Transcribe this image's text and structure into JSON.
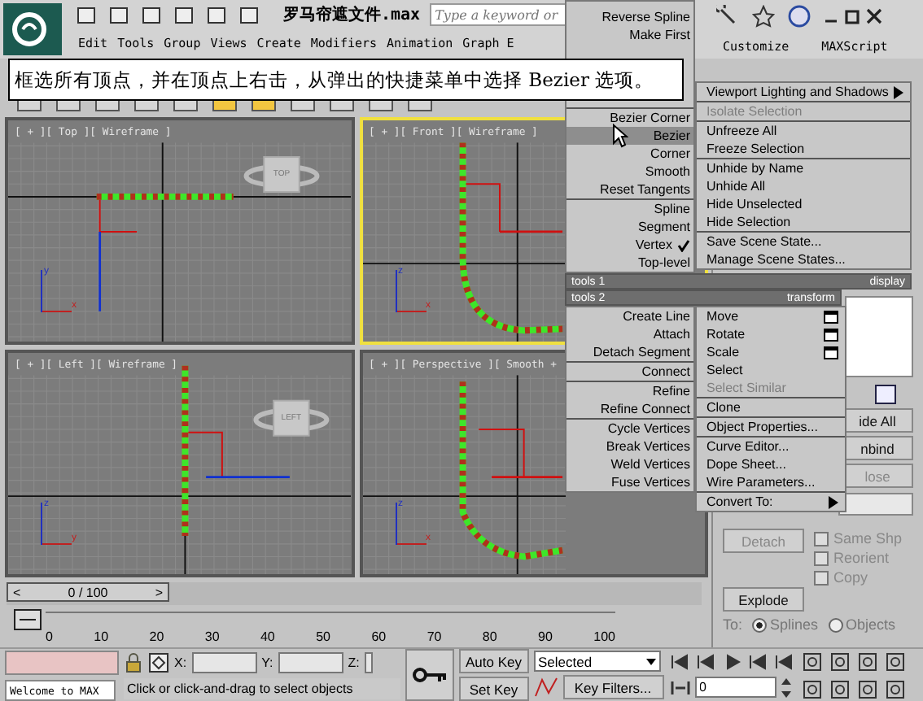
{
  "title_bar": {
    "file_name": "罗马帘遮文件.max",
    "search": {
      "placeholder": "Type a keyword or"
    }
  },
  "menu_bar": [
    "Edit",
    "Tools",
    "Group",
    "Views",
    "Create",
    "Modifiers",
    "Animation",
    "Graph E"
  ],
  "menu_bar_right": [
    "Customize",
    "MAXScript"
  ],
  "caption": "框选所有顶点，并在顶点上右击，从弹出的快捷菜单中选择 Bezier 选项。",
  "viewports": [
    {
      "label": "[ + ][ Top ][ Wireframe ]",
      "selected": false,
      "viewcube": "TOP",
      "tripod": [
        "y",
        "x"
      ]
    },
    {
      "label": "[ + ][ Front ][ Wireframe ]",
      "selected": true,
      "tripod": [
        "z",
        "x"
      ]
    },
    {
      "label": "[ + ][ Left ][ Wireframe ]",
      "selected": false,
      "viewcube": "LEFT",
      "tripod": [
        "z",
        "y"
      ]
    },
    {
      "label": "[ + ][ Perspective ][ Smooth +",
      "selected": false,
      "tripod": [
        "z",
        "x"
      ]
    }
  ],
  "quad_menu": {
    "top_left": [
      [
        {
          "label": "Reverse Spline",
          "selected": false,
          "checked": false,
          "disabled": false
        },
        {
          "label": "Make First",
          "selected": false,
          "checked": false,
          "disabled": false
        }
      ],
      [
        {
          "label": "Bezier Corner",
          "selected": false,
          "checked": false,
          "disabled": false
        },
        {
          "label": "Bezier",
          "selected": true,
          "checked": false,
          "disabled": false
        },
        {
          "label": "Corner",
          "selected": false,
          "checked": false,
          "disabled": false
        },
        {
          "label": "Smooth",
          "selected": false,
          "checked": false,
          "disabled": false
        },
        {
          "label": "Reset Tangents",
          "selected": false,
          "checked": false,
          "disabled": false
        }
      ],
      [
        {
          "label": "Spline",
          "selected": false,
          "checked": false,
          "disabled": false
        },
        {
          "label": "Segment",
          "selected": false,
          "checked": false,
          "disabled": false
        },
        {
          "label": "Vertex",
          "selected": false,
          "checked": true,
          "disabled": false
        },
        {
          "label": "Top-level",
          "selected": false,
          "checked": false,
          "disabled": false
        }
      ]
    ],
    "top_right": [
      [
        {
          "label": "Viewport Lighting and Shadows",
          "kind": "submenu",
          "selected": false,
          "checked": false,
          "disabled": false
        }
      ],
      [
        {
          "label": "Isolate Selection",
          "kind": "plain",
          "selected": false,
          "checked": false,
          "disabled": true
        }
      ],
      [
        {
          "label": "Unfreeze All",
          "kind": "plain",
          "selected": false,
          "checked": false,
          "disabled": false
        },
        {
          "label": "Freeze Selection",
          "kind": "plain",
          "selected": false,
          "checked": false,
          "disabled": false
        }
      ],
      [
        {
          "label": "Unhide by Name",
          "kind": "plain",
          "selected": false,
          "checked": false,
          "disabled": false
        },
        {
          "label": "Unhide All",
          "kind": "plain",
          "selected": false,
          "checked": false,
          "disabled": false
        },
        {
          "label": "Hide Unselected",
          "kind": "plain",
          "selected": false,
          "checked": false,
          "disabled": false
        },
        {
          "label": "Hide Selection",
          "kind": "plain",
          "selected": false,
          "checked": false,
          "disabled": false
        }
      ],
      [
        {
          "label": "Save Scene State...",
          "kind": "plain",
          "selected": false,
          "checked": false,
          "disabled": false
        },
        {
          "label": "Manage Scene States...",
          "kind": "plain",
          "selected": false,
          "checked": false,
          "disabled": false
        }
      ]
    ],
    "header_1": {
      "left": "tools 1",
      "right": "display"
    },
    "header_2": {
      "left": "tools 2",
      "right": "transform"
    },
    "bottom_left": [
      [
        {
          "label": "Create Line",
          "selected": false,
          "checked": false,
          "disabled": false
        },
        {
          "label": "Attach",
          "selected": false,
          "checked": false,
          "disabled": false
        },
        {
          "label": "Detach Segment",
          "selected": false,
          "checked": false,
          "disabled": false
        }
      ],
      [
        {
          "label": "Connect",
          "selected": false,
          "checked": false,
          "disabled": false
        }
      ],
      [
        {
          "label": "Refine",
          "selected": false,
          "checked": false,
          "disabled": false
        },
        {
          "label": "Refine Connect",
          "selected": false,
          "checked": false,
          "disabled": false
        }
      ],
      [
        {
          "label": "Cycle Vertices",
          "selected": false,
          "checked": false,
          "disabled": false
        },
        {
          "label": "Break Vertices",
          "selected": false,
          "checked": false,
          "disabled": false
        },
        {
          "label": "Weld Vertices",
          "selected": false,
          "checked": false,
          "disabled": false
        },
        {
          "label": "Fuse Vertices",
          "selected": false,
          "checked": false,
          "disabled": false
        }
      ]
    ],
    "bottom_right": [
      [
        {
          "label": "Move",
          "kind": "options",
          "selected": false,
          "checked": false,
          "disabled": false
        },
        {
          "label": "Rotate",
          "kind": "options",
          "selected": false,
          "checked": false,
          "disabled": false
        },
        {
          "label": "Scale",
          "kind": "options",
          "selected": false,
          "checked": false,
          "disabled": false
        },
        {
          "label": "Select",
          "kind": "plain",
          "selected": false,
          "checked": false,
          "disabled": false
        },
        {
          "label": "Select Similar",
          "kind": "plain",
          "selected": false,
          "checked": false,
          "disabled": true
        }
      ],
      [
        {
          "label": "Clone",
          "kind": "plain",
          "selected": false,
          "checked": false,
          "disabled": false
        }
      ],
      [
        {
          "label": "Object Properties...",
          "kind": "plain",
          "selected": false,
          "checked": false,
          "disabled": false
        }
      ],
      [
        {
          "label": "Curve Editor...",
          "kind": "plain",
          "selected": false,
          "checked": false,
          "disabled": false
        },
        {
          "label": "Dope Sheet...",
          "kind": "plain",
          "selected": false,
          "checked": false,
          "disabled": false
        },
        {
          "label": "Wire Parameters...",
          "kind": "plain",
          "selected": false,
          "checked": false,
          "disabled": false
        }
      ],
      [
        {
          "label": "Convert To:",
          "kind": "submenu",
          "selected": false,
          "checked": false,
          "disabled": false
        }
      ]
    ]
  },
  "command_panel": {
    "buttons": [
      {
        "label": "ide All",
        "disabled": false
      },
      {
        "label": "nbind",
        "disabled": false
      },
      {
        "label": "lose",
        "disabled": true
      }
    ],
    "detach": {
      "label": "Detach",
      "disabled": true
    },
    "checkboxes": [
      {
        "label": "Same Shp",
        "checked": false,
        "disabled": true
      },
      {
        "label": "Reorient",
        "checked": false,
        "disabled": true
      },
      {
        "label": "Copy",
        "checked": false,
        "disabled": true
      }
    ],
    "explode": {
      "label": "Explode"
    },
    "to_label": "To:",
    "radios": [
      {
        "label": "Splines",
        "selected": true
      },
      {
        "label": "Objects",
        "selected": false
      }
    ]
  },
  "timeline": {
    "slider_label": "0 / 100",
    "level": 0,
    "prev": "<",
    "next": ">",
    "ticks": [
      "0",
      "10",
      "20",
      "30",
      "40",
      "50",
      "60",
      "70",
      "80",
      "90",
      "100"
    ]
  },
  "status_bar": {
    "listener": "Welcome to MAX",
    "prompt": "Click or click-and-drag to select objects",
    "coords": [
      "X:",
      "Y:",
      "Z:"
    ],
    "auto_key": "Auto Key",
    "set_key": "Set Key",
    "key_mode": "Selected",
    "key_filters": "Key Filters...",
    "frame": "0"
  }
}
